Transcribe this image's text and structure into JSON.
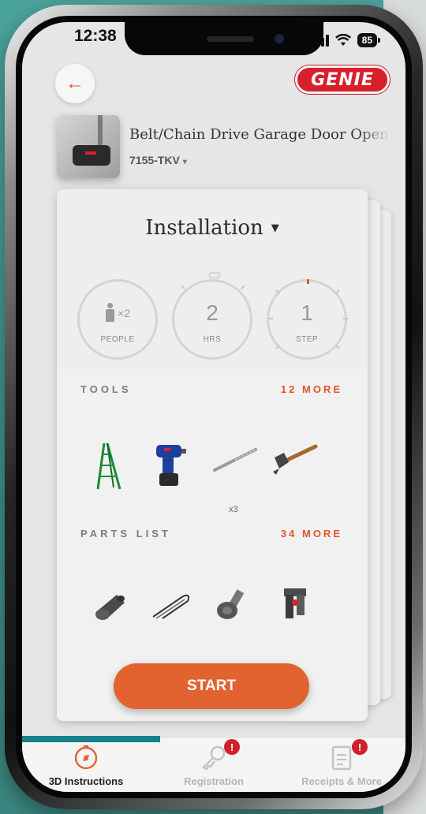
{
  "status_bar": {
    "time": "12:38",
    "battery": "85"
  },
  "header": {
    "back_label": "←",
    "brand_logo": "GENIE"
  },
  "product": {
    "title": "Belt/Chain Drive Garage Door Opener",
    "model": "7155-TKV",
    "model_caret": "▾"
  },
  "instructions_card": {
    "title": "Installation",
    "title_caret": "▼",
    "stats": [
      {
        "value": "×2",
        "label": "PEOPLE",
        "icon": "person-icon"
      },
      {
        "value": "2",
        "label": "HRS",
        "icon": "stopwatch-icon"
      },
      {
        "value": "1",
        "label": "STEP",
        "icon": "dial-icon"
      }
    ],
    "tools": {
      "label": "TOOLS",
      "more": "12 MORE",
      "items": [
        {
          "icon": "ladder-icon"
        },
        {
          "icon": "drill-icon"
        },
        {
          "icon": "drill-bit-icon",
          "qty": "x3"
        },
        {
          "icon": "hammer-icon"
        }
      ]
    },
    "parts": {
      "label": "PARTS LIST",
      "more": "34 MORE",
      "items": [
        {
          "icon": "bolt-cap-icon"
        },
        {
          "icon": "wire-clip-icon"
        },
        {
          "icon": "pulley-shaft-icon"
        },
        {
          "icon": "bracket-icon"
        }
      ]
    },
    "start_label": "START"
  },
  "tab_bar": {
    "progress": 0.36,
    "tabs": [
      {
        "label": "3D Instructions",
        "icon": "compass-icon",
        "active": true,
        "badge": ""
      },
      {
        "label": "Registration",
        "icon": "key-icon",
        "active": false,
        "badge": "!"
      },
      {
        "label": "Receipts & More",
        "icon": "receipt-icon",
        "active": false,
        "badge": "!"
      }
    ]
  },
  "colors": {
    "accent": "#e2632f",
    "brand_red": "#d8202c",
    "teal_progress": "#14818b"
  }
}
